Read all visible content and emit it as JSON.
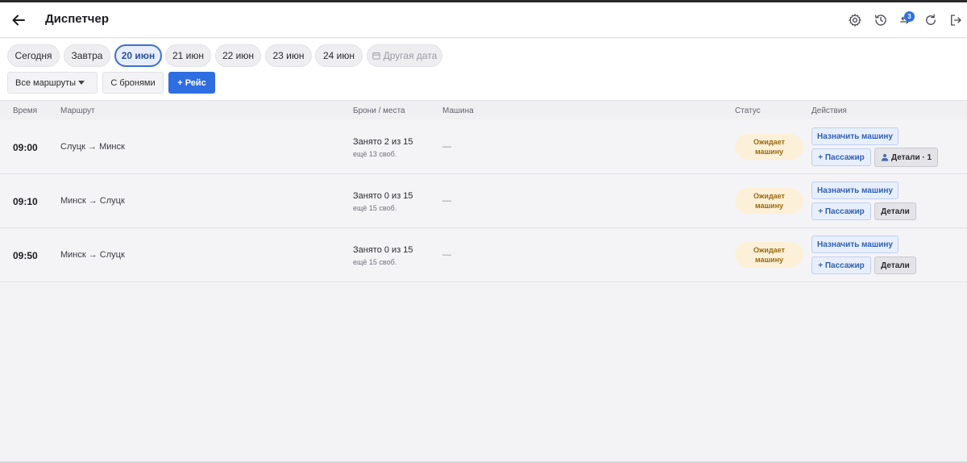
{
  "header": {
    "title": "Диспетчер",
    "notifications_count": "3"
  },
  "dates": {
    "chips": [
      "Сегодня",
      "Завтра",
      "20 июн",
      "21 июн",
      "22 июн",
      "23 июн",
      "24 июн"
    ],
    "active_index": 2,
    "other_date": "Другая дата"
  },
  "filters": {
    "routes_select": "Все маршруты",
    "with_bookings": "С бронями",
    "add_trip": "+ Рейс"
  },
  "table": {
    "columns": {
      "time": "Время",
      "route": "Маршрут",
      "bookings": "Брони / места",
      "car": "Машина",
      "status": "Статус",
      "actions": "Действия"
    },
    "rows": [
      {
        "time": "09:00",
        "route": "Слуцк → Минск",
        "occupied": "Занято 2 из 15",
        "free": "ещё 13 своб.",
        "car": "—",
        "status_line1": "Ожидает",
        "status_line2": "машину",
        "assign": "Назначить машину",
        "passenger": "+ Пассажир",
        "details": "Детали · 1"
      },
      {
        "time": "09:10",
        "route": "Минск → Слуцк",
        "occupied": "Занято 0 из 15",
        "free": "ещё 15 своб.",
        "car": "—",
        "status_line1": "Ожидает",
        "status_line2": "машину",
        "assign": "Назначить машину",
        "passenger": "+ Пассажир",
        "details": "Детали"
      },
      {
        "time": "09:50",
        "route": "Минск → Слуцк",
        "occupied": "Занято 0 из 15",
        "free": "ещё 15 своб.",
        "car": "—",
        "status_line1": "Ожидает",
        "status_line2": "машину",
        "assign": "Назначить машину",
        "passenger": "+ Пассажир",
        "details": "Детали"
      }
    ]
  },
  "colors": {
    "accent": "#2f6ee0",
    "status_bg": "#fdf0d8",
    "status_text": "#9a6a10"
  },
  "icons": [
    "back-arrow-icon",
    "settings-gear-icon",
    "history-icon",
    "sync-arrows-icon",
    "refresh-icon",
    "logout-icon",
    "calendar-icon",
    "person-icon"
  ]
}
